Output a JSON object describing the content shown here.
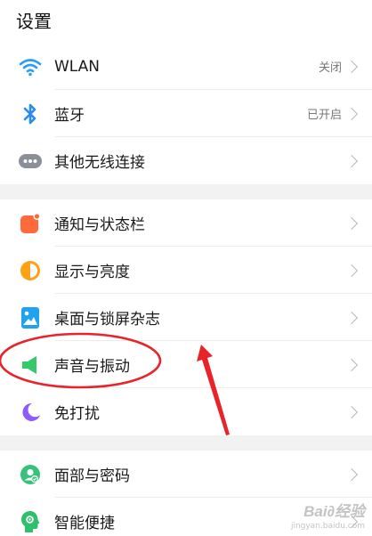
{
  "header": {
    "title": "设置"
  },
  "groups": [
    {
      "items": [
        {
          "icon": "wifi-icon",
          "label": "WLAN",
          "value": "关闭"
        },
        {
          "icon": "bluetooth-icon",
          "label": "蓝牙",
          "value": "已开启"
        },
        {
          "icon": "more-connections-icon",
          "label": "其他无线连接",
          "value": ""
        }
      ]
    },
    {
      "items": [
        {
          "icon": "notification-icon",
          "label": "通知与状态栏",
          "value": ""
        },
        {
          "icon": "display-brightness-icon",
          "label": "显示与亮度",
          "value": ""
        },
        {
          "icon": "wallpaper-icon",
          "label": "桌面与锁屏杂志",
          "value": ""
        },
        {
          "icon": "speaker-icon",
          "label": "声音与振动",
          "value": ""
        },
        {
          "icon": "moon-icon",
          "label": "免打扰",
          "value": ""
        }
      ]
    },
    {
      "items": [
        {
          "icon": "face-id-icon",
          "label": "面部与密码",
          "value": ""
        },
        {
          "icon": "smart-assist-icon",
          "label": "智能便捷",
          "value": ""
        }
      ]
    }
  ],
  "watermark": {
    "main": "Bai∂经验",
    "sub": "jingyan.baidu.com"
  },
  "colors": {
    "wifi": "#2a9df4",
    "bluetooth": "#2a8cf0",
    "more": "#8a8f9a",
    "notification": "#ff6a3d",
    "display": "#ffa114",
    "wallpaper": "#1fa3f0",
    "speaker": "#35c96a",
    "moon": "#8e5cf6",
    "face": "#36c27b",
    "smart": "#2fc06c",
    "annotation": "#e8232a"
  }
}
